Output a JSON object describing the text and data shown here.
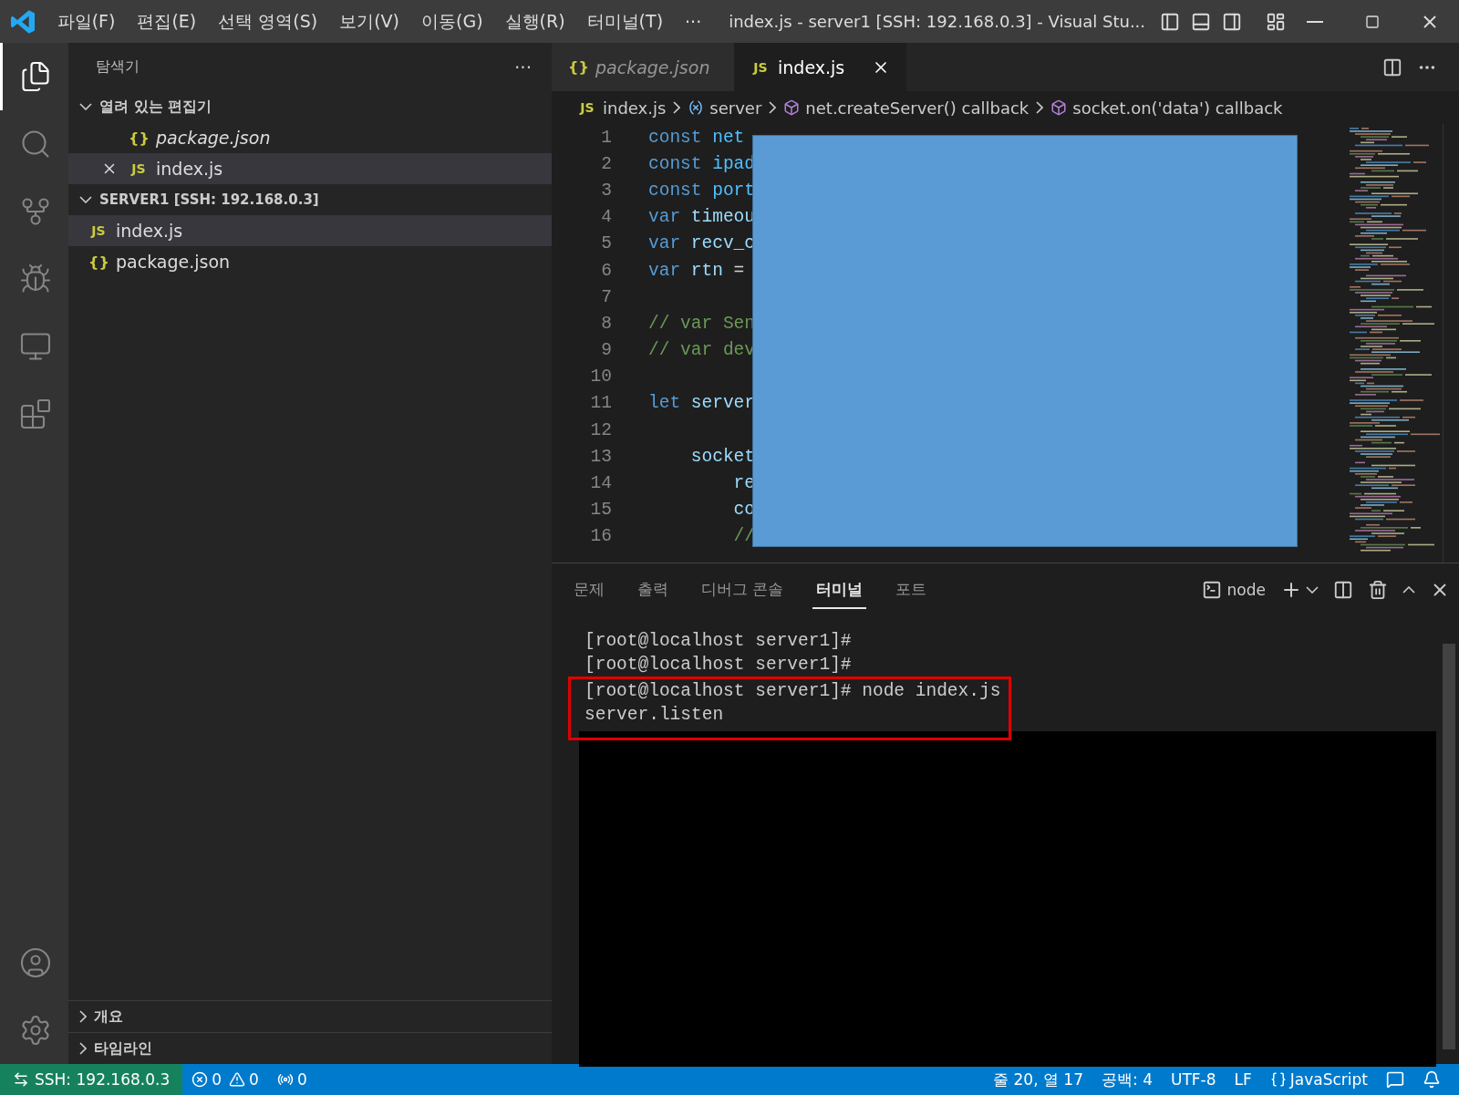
{
  "window": {
    "title": "index.js - server1 [SSH: 192.168.0.3] - Visual Stu...",
    "menu": [
      "파일(F)",
      "편집(E)",
      "선택 영역(S)",
      "보기(V)",
      "이동(G)",
      "실행(R)",
      "터미널(T)",
      "···"
    ]
  },
  "activity_bar": {
    "items": [
      {
        "kind": "explorer",
        "selected": true
      },
      {
        "kind": "search",
        "selected": false
      },
      {
        "kind": "source-control",
        "selected": false
      },
      {
        "kind": "run",
        "selected": false
      },
      {
        "kind": "remote",
        "selected": false
      },
      {
        "kind": "extensions",
        "selected": false
      }
    ]
  },
  "sidebar": {
    "title": "탐색기",
    "more": "···",
    "sections": [
      {
        "label": "열려 있는 편집기",
        "expanded": true,
        "items": [
          {
            "kind": "json",
            "icon_text": "{}",
            "name": "package.json",
            "italic": true,
            "closable": false,
            "selected": false
          },
          {
            "kind": "js",
            "icon_text": "JS",
            "name": "index.js",
            "italic": false,
            "closable": true,
            "selected": true
          }
        ]
      },
      {
        "label": "SERVER1 [SSH: 192.168.0.3]",
        "expanded": true,
        "items": [
          {
            "kind": "js",
            "icon_text": "JS",
            "name": "index.js",
            "selected": true
          },
          {
            "kind": "json",
            "icon_text": "{}",
            "name": "package.json",
            "selected": false
          }
        ]
      }
    ],
    "bottom_sections": [
      {
        "label": "개요",
        "expanded": false
      },
      {
        "label": "타임라인",
        "expanded": false
      }
    ]
  },
  "editor": {
    "tabs": [
      {
        "kind": "json",
        "icon_text": "{}",
        "label": "package.json",
        "italic": true,
        "selected": false
      },
      {
        "kind": "js",
        "icon_text": "JS",
        "label": "index.js",
        "italic": false,
        "selected": true
      }
    ],
    "breadcrumb": [
      {
        "kind": "file",
        "icon_text": "JS",
        "label": "index.js"
      },
      {
        "kind": "variable",
        "label": "server"
      },
      {
        "kind": "method",
        "label": "net.createServer() callback"
      },
      {
        "kind": "method",
        "label": "socket.on('data') callback"
      }
    ],
    "lines": [
      {
        "number": "1",
        "tokens": [
          {
            "kind": "keyword",
            "text": "const"
          },
          {
            "kind": "constant",
            "text": " net"
          }
        ]
      },
      {
        "number": "2",
        "tokens": [
          {
            "kind": "keyword",
            "text": "const"
          },
          {
            "kind": "constant",
            "text": " ipad"
          }
        ]
      },
      {
        "number": "3",
        "tokens": [
          {
            "kind": "keyword",
            "text": "const"
          },
          {
            "kind": "constant",
            "text": " port"
          }
        ]
      },
      {
        "number": "4",
        "tokens": [
          {
            "kind": "keyword",
            "text": "var"
          },
          {
            "kind": "variable",
            "text": " timeou"
          }
        ]
      },
      {
        "number": "5",
        "tokens": [
          {
            "kind": "keyword",
            "text": "var"
          },
          {
            "kind": "variable",
            "text": " recv_c"
          }
        ]
      },
      {
        "number": "6",
        "tokens": [
          {
            "kind": "keyword",
            "text": "var"
          },
          {
            "kind": "variable",
            "text": " rtn"
          },
          {
            "kind": "plain",
            "text": " ="
          }
        ]
      },
      {
        "number": "7"
      },
      {
        "number": "8",
        "tokens": [
          {
            "kind": "comment",
            "text": "// var Sen"
          }
        ]
      },
      {
        "number": "9",
        "tokens": [
          {
            "kind": "comment",
            "text": "// var dev"
          }
        ]
      },
      {
        "number": "10"
      },
      {
        "number": "11",
        "tokens": [
          {
            "kind": "keyword",
            "text": "let"
          },
          {
            "kind": "variable",
            "text": " server"
          }
        ]
      },
      {
        "number": "12"
      },
      {
        "number": "13",
        "tokens": [
          {
            "kind": "variable",
            "text": "    socket"
          }
        ]
      },
      {
        "number": "14",
        "tokens": [
          {
            "kind": "variable",
            "text": "        re"
          }
        ]
      },
      {
        "number": "15",
        "tokens": [
          {
            "kind": "variable",
            "text": "        co"
          }
        ]
      },
      {
        "number": "16",
        "tokens": [
          {
            "kind": "comment",
            "text": "        //"
          }
        ]
      }
    ]
  },
  "panel": {
    "tabs": [
      {
        "label": "문제",
        "selected": false
      },
      {
        "label": "출력",
        "selected": false
      },
      {
        "label": "디버그 콘솔",
        "selected": false
      },
      {
        "label": "터미널",
        "selected": true
      },
      {
        "label": "포트",
        "selected": false
      }
    ],
    "terminal_name": "node",
    "terminal_lines": [
      {
        "text": "[root@localhost server1]#",
        "highlighted": false
      },
      {
        "text": "[root@localhost server1]#",
        "highlighted": false
      },
      {
        "text": "[root@localhost server1]# node index.js",
        "highlighted": true
      },
      {
        "text": "server.listen",
        "highlighted": true
      }
    ]
  },
  "status_bar": {
    "remote": "SSH: 192.168.0.3",
    "errors": "0",
    "warnings": "0",
    "ports": "0",
    "position": "줄 20, 열 17",
    "spaces": "공백: 4",
    "encoding": "UTF-8",
    "eol": "LF",
    "language": "JavaScript"
  }
}
